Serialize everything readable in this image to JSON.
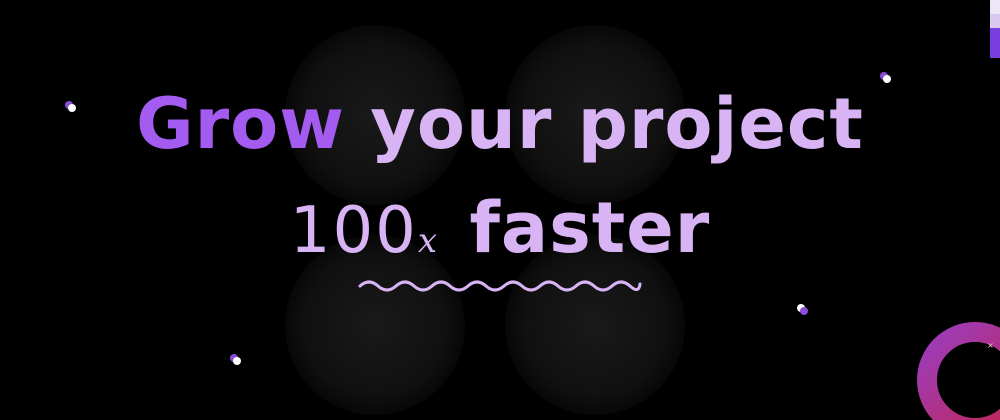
{
  "headline": {
    "word_accent": "Grow",
    "line1_rest": "your project",
    "number": "100",
    "multiplier": "x",
    "line2_rest": "faster"
  },
  "colors": {
    "background": "#000000",
    "accent_purple": "#a45bf0",
    "light_lilac": "#d8b4f5",
    "ring_start": "#9b3dbd",
    "ring_end": "#c4254f"
  },
  "icons": {
    "squiggle": "wavy-underline-icon",
    "dots": "orbit-dot-icon",
    "ring": "gradient-ring-icon"
  }
}
